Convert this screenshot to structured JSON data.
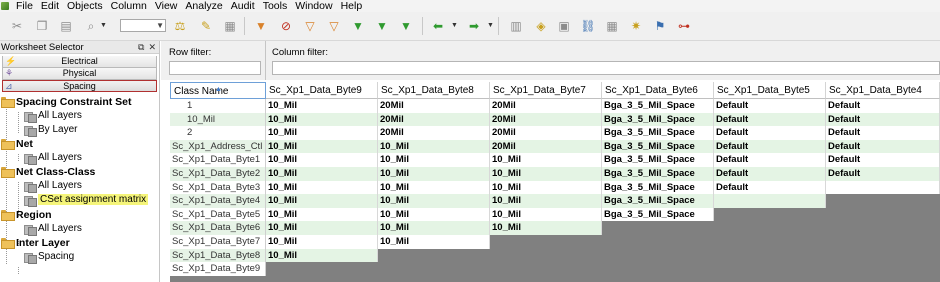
{
  "menubar": {
    "items": [
      "File",
      "Edit",
      "Objects",
      "Column",
      "View",
      "Analyze",
      "Audit",
      "Tools",
      "Window",
      "Help"
    ]
  },
  "toolbar": {
    "zoom_value": "",
    "icons": [
      "cut-icon",
      "copy-icon",
      "paste-icon",
      "undo-icon",
      "redo-icon",
      "find-icon",
      "filter-icon",
      "filter-clear-icon",
      "filter-add-icon",
      "filter-remove-icon",
      "filter-edit-icon",
      "filter-apply-icon",
      "back-arrow-icon",
      "forward-arrow-icon",
      "analysis-icon",
      "edit-constraint-icon",
      "network-icon",
      "tree-icon",
      "group-icon",
      "highlight-icon",
      "lightbulb-icon",
      "resistor-icon"
    ]
  },
  "worksheet_selector": {
    "title": "Worksheet Selector",
    "tabs": [
      "Electrical",
      "Physical",
      "Spacing"
    ],
    "selected_tab": "Spacing",
    "tree": [
      {
        "label": "Spacing Constraint Set",
        "children": [
          "All Layers",
          "By Layer"
        ]
      },
      {
        "label": "Net",
        "children": [
          "All Layers"
        ]
      },
      {
        "label": "Net Class-Class",
        "children": [
          "All Layers",
          "CSet assignment matrix"
        ]
      },
      {
        "label": "Region",
        "children": [
          "All Layers"
        ]
      },
      {
        "label": "Inter Layer",
        "children": [
          "Spacing"
        ]
      }
    ],
    "highlighted_item": "CSet assignment matrix"
  },
  "filters": {
    "row_filter_label": "Row filter:",
    "column_filter_label": "Column filter:",
    "row_filter_value": "",
    "column_filter_value": ""
  },
  "grid": {
    "corner_label": "Class Name",
    "columns": [
      "Sc_Xp1_Data_Byte9",
      "Sc_Xp1_Data_Byte8",
      "Sc_Xp1_Data_Byte7",
      "Sc_Xp1_Data_Byte6",
      "Sc_Xp1_Data_Byte5",
      "Sc_Xp1_Data_Byte4"
    ],
    "rows": [
      {
        "name": "1",
        "cells": [
          "10_Mil",
          "20Mil",
          "20Mil",
          "Bga_3_5_Mil_Space",
          "Default",
          "Default"
        ]
      },
      {
        "name": "10_Mil",
        "cells": [
          "10_Mil",
          "20Mil",
          "20Mil",
          "Bga_3_5_Mil_Space",
          "Default",
          "Default"
        ]
      },
      {
        "name": "2",
        "cells": [
          "10_Mil",
          "20Mil",
          "20Mil",
          "Bga_3_5_Mil_Space",
          "Default",
          "Default"
        ]
      },
      {
        "name": "Sc_Xp1_Address_Ctl",
        "cells": [
          "10_Mil",
          "10_Mil",
          "20Mil",
          "Bga_3_5_Mil_Space",
          "Default",
          "Default"
        ]
      },
      {
        "name": "Sc_Xp1_Data_Byte1",
        "cells": [
          "10_Mil",
          "10_Mil",
          "10_Mil",
          "Bga_3_5_Mil_Space",
          "Default",
          "Default"
        ]
      },
      {
        "name": "Sc_Xp1_Data_Byte2",
        "cells": [
          "10_Mil",
          "10_Mil",
          "10_Mil",
          "Bga_3_5_Mil_Space",
          "Default",
          "Default"
        ]
      },
      {
        "name": "Sc_Xp1_Data_Byte3",
        "cells": [
          "10_Mil",
          "10_Mil",
          "10_Mil",
          "Bga_3_5_Mil_Space",
          "Default",
          ""
        ]
      },
      {
        "name": "Sc_Xp1_Data_Byte4",
        "cells": [
          "10_Mil",
          "10_Mil",
          "10_Mil",
          "Bga_3_5_Mil_Space",
          "",
          ""
        ]
      },
      {
        "name": "Sc_Xp1_Data_Byte5",
        "cells": [
          "10_Mil",
          "10_Mil",
          "10_Mil",
          "Bga_3_5_Mil_Space",
          "",
          ""
        ]
      },
      {
        "name": "Sc_Xp1_Data_Byte6",
        "cells": [
          "10_Mil",
          "10_Mil",
          "10_Mil",
          "Bga_3_5_Mil_Space",
          "",
          ""
        ]
      },
      {
        "name": "Sc_Xp1_Data_Byte7",
        "cells": [
          "10_Mil",
          "10_Mil",
          "20Mil",
          "",
          "",
          ""
        ]
      },
      {
        "name": "Sc_Xp1_Data_Byte8",
        "cells": [
          "10_Mil",
          "10_Mil",
          "",
          "",
          "",
          ""
        ]
      },
      {
        "name": "Sc_Xp1_Data_Byte9",
        "cells": [
          "10_Mil",
          "",
          "",
          "",
          "",
          ""
        ]
      }
    ]
  }
}
